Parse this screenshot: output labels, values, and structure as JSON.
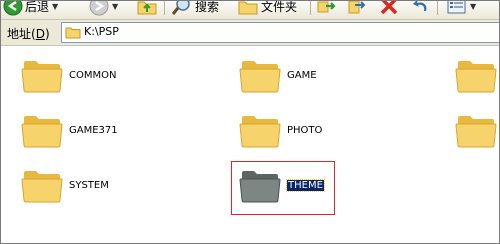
{
  "toolbar": {
    "back_label": "后退",
    "search_label": "搜索",
    "folders_label": "文件夹"
  },
  "address": {
    "label": "地址",
    "hotkey": "D",
    "path": "K:\\PSP"
  },
  "folders": [
    {
      "name": "COMMON",
      "selected": false
    },
    {
      "name": "GAME",
      "selected": false
    },
    {
      "name": "GAME371",
      "selected": false
    },
    {
      "name": "PHOTO",
      "selected": false
    },
    {
      "name": "SYSTEM",
      "selected": false
    },
    {
      "name": "THEME",
      "selected": true
    }
  ],
  "colors": {
    "folder_yellow": "#f7d46b",
    "selection": "#0a246a",
    "highlight": "#e0262b"
  }
}
